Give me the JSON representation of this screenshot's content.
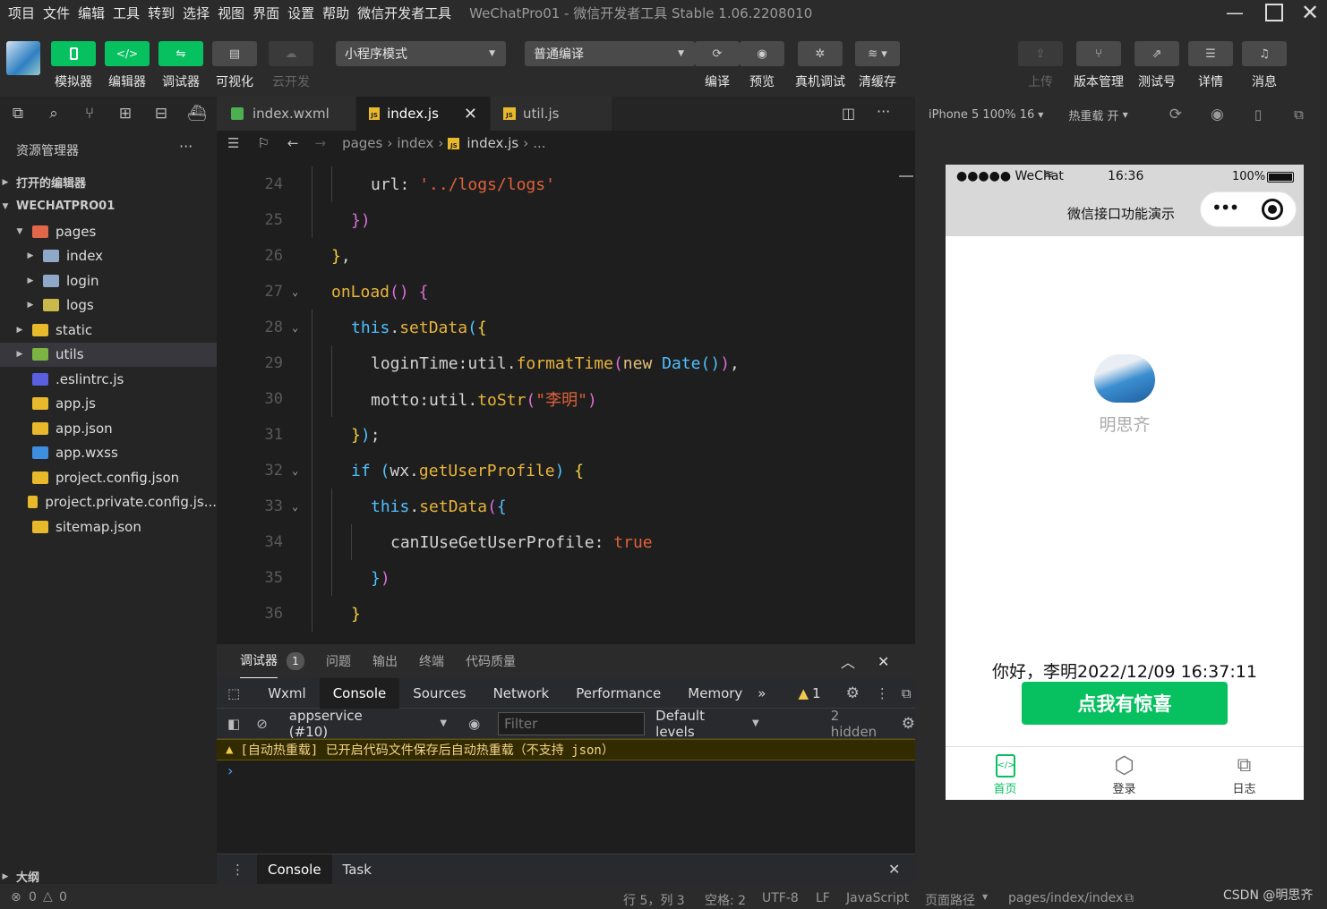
{
  "menu": {
    "items": [
      "项目",
      "文件",
      "编辑",
      "工具",
      "转到",
      "选择",
      "视图",
      "界面",
      "设置",
      "帮助",
      "微信开发者工具"
    ],
    "title": "WeChatPro01 - 微信开发者工具 Stable 1.06.2208010"
  },
  "toolbar": {
    "simulator": "模拟器",
    "editor": "编辑器",
    "debugger": "调试器",
    "visual": "可视化",
    "cloud": "云开发",
    "mode_select": "小程序模式",
    "compile_select": "普通编译",
    "compile": "编译",
    "preview": "预览",
    "real_debug": "真机调试",
    "clear_cache": "清缓存",
    "upload": "上传",
    "version": "版本管理",
    "test_account": "测试号",
    "details": "详情",
    "messages": "消息"
  },
  "explorer": {
    "title": "资源管理器",
    "more": "···",
    "open_editors": "打开的编辑器",
    "project": "WECHATPRO01",
    "outline": "大纲",
    "items": [
      {
        "label": "pages",
        "depth": 1,
        "arrow": "▼",
        "icon": "folder-pages-icon",
        "color": "#e2674a"
      },
      {
        "label": "index",
        "depth": 2,
        "arrow": "▶",
        "icon": "folder-icon",
        "color": "#8fa8c8"
      },
      {
        "label": "login",
        "depth": 2,
        "arrow": "▶",
        "icon": "folder-icon",
        "color": "#8fa8c8"
      },
      {
        "label": "logs",
        "depth": 2,
        "arrow": "▶",
        "icon": "folder-logs-icon",
        "color": "#c9b94a"
      },
      {
        "label": "static",
        "depth": 1,
        "arrow": "▶",
        "icon": "folder-static-icon",
        "color": "#e8b92b"
      },
      {
        "label": "utils",
        "depth": 1,
        "arrow": "▶",
        "icon": "folder-utils-icon",
        "color": "#7cb342"
      },
      {
        "label": ".eslintrc.js",
        "depth": 1,
        "arrow": "",
        "icon": "eslint-icon",
        "color": "#5a5ee0"
      },
      {
        "label": "app.js",
        "depth": 1,
        "arrow": "",
        "icon": "js-file-icon",
        "color": "#e8b92b"
      },
      {
        "label": "app.json",
        "depth": 1,
        "arrow": "",
        "icon": "json-file-icon",
        "color": "#e8b92b"
      },
      {
        "label": "app.wxss",
        "depth": 1,
        "arrow": "",
        "icon": "wxss-file-icon",
        "color": "#3f8fe0"
      },
      {
        "label": "project.config.json",
        "depth": 1,
        "arrow": "",
        "icon": "json-file-icon",
        "color": "#e8b92b"
      },
      {
        "label": "project.private.config.js...",
        "depth": 1,
        "arrow": "",
        "icon": "json-file-icon",
        "color": "#e8b92b"
      },
      {
        "label": "sitemap.json",
        "depth": 1,
        "arrow": "",
        "icon": "json-file-icon",
        "color": "#e8b92b"
      }
    ]
  },
  "editor": {
    "tabs": [
      "index.wxml",
      "index.js",
      "util.js"
    ],
    "breadcrumb": [
      "pages",
      "index",
      "index.js",
      "..."
    ],
    "lines": [
      {
        "n": "24",
        "indent": 3,
        "html": "<span class='p'>url</span><span class='p'>: </span><span class='s'>'../logs/logs'</span>"
      },
      {
        "n": "25",
        "indent": 2,
        "html": "<span class='b2'>})</span>"
      },
      {
        "n": "26",
        "indent": 1,
        "html": "<span class='b1'>}</span><span class='p'>,</span>"
      },
      {
        "n": "27",
        "indent": 1,
        "html": "<span class='f'>onLoad</span><span class='b2'>()</span><span class='p'> </span><span class='b2'>{</span>"
      },
      {
        "n": "28",
        "indent": 2,
        "html": "<span class='k'>this</span><span class='p'>.</span><span class='f'>setData</span><span class='b3'>(</span><span class='b1'>{</span>"
      },
      {
        "n": "29",
        "indent": 3,
        "html": "<span class='p'>loginTime</span><span class='p'>:util.</span><span class='f'>formatTime</span><span class='b2'>(</span><span class='vr'>new</span><span class='p'> </span><span class='k'>Date</span><span class='b3'>()</span><span class='b2'>)</span><span class='p'>,</span>"
      },
      {
        "n": "30",
        "indent": 3,
        "html": "<span class='p'>motto</span><span class='p'>:util.</span><span class='f'>toStr</span><span class='b2'>(</span><span class='s'>\"李明\"</span><span class='b2'>)</span>"
      },
      {
        "n": "31",
        "indent": 2,
        "html": "<span class='b1'>}</span><span class='b3'>)</span><span class='p'>;</span>"
      },
      {
        "n": "32",
        "indent": 2,
        "html": "<span class='k'>if</span><span class='p'> </span><span class='b3'>(</span><span class='p'>wx.</span><span class='f'>getUserProfile</span><span class='b3'>)</span><span class='p'> </span><span class='b1'>{</span>"
      },
      {
        "n": "33",
        "indent": 3,
        "html": "<span class='k'>this</span><span class='p'>.</span><span class='f'>setData</span><span class='b2'>(</span><span class='b3'>{</span>"
      },
      {
        "n": "34",
        "indent": 4,
        "html": "<span class='p'>canIUseGetUserProfile</span><span class='p'>: </span><span class='s'>true</span>"
      },
      {
        "n": "35",
        "indent": 3,
        "html": "<span class='b3'>}</span><span class='b2'>)</span>"
      },
      {
        "n": "36",
        "indent": 2,
        "html": "<span class='b1'>}</span>"
      }
    ]
  },
  "devtools": {
    "panel_tabs": [
      "调试器",
      "问题",
      "输出",
      "终端",
      "代码质量"
    ],
    "badge": "1",
    "tabs": [
      "Wxml",
      "Console",
      "Sources",
      "Network",
      "Performance",
      "Memory"
    ],
    "more": "»",
    "warn_count": "1",
    "context": "appservice (#10)",
    "filter_placeholder": "Filter",
    "levels": "Default levels",
    "hidden": "2 hidden",
    "warning_message": "[自动热重载] 已开启代码文件保存后自动热重载（不支持 json）",
    "prompt": "›",
    "drawer_tabs": [
      "Console",
      "Task"
    ]
  },
  "simulator": {
    "device": "iPhone 5 100% 16",
    "hot_reload": "热重载 开",
    "carrier": "●●●●● WeChat",
    "time": "16:36",
    "battery": "100%",
    "nav_title": "微信接口功能演示",
    "user_name": "明思齐",
    "greeting": "你好，李明2022/12/09 16:37:11",
    "button": "点我有惊喜",
    "tabbar": [
      "首页",
      "登录",
      "日志"
    ]
  },
  "statusbar": {
    "errors": "0",
    "warnings": "0",
    "position": "行 5，列 3",
    "spaces": "空格: 2",
    "encoding": "UTF-8",
    "eol": "LF",
    "language": "JavaScript",
    "page_path_label": "页面路径",
    "page_path": "pages/index/index",
    "watermark": "CSDN @明思齐"
  },
  "colors": {
    "accent": "#07c160",
    "background": "#2b2b2b",
    "editor_bg": "#1e1e1e"
  }
}
